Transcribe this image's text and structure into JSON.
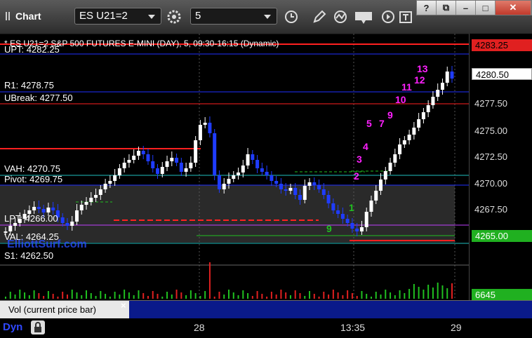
{
  "toolbar": {
    "title": "Chart",
    "symbol": "ES U21=2",
    "interval": "5"
  },
  "chart": {
    "header": "* ES U21=2 S&P 500 FUTURES E-MINI (DAY), 5, 09:30-16:15 (Dynamic)",
    "levels": {
      "upt": "UPT: 4282.25",
      "r1": "R1: 4278.75",
      "ubreak": "UBreak: 4277.50",
      "vah": "VAH: 4270.75",
      "pivot": "Pivot: 4269.75",
      "lpt": "LPT: 4266.00",
      "val": "VAL: 4264.25",
      "s1": "S1: 4262.50"
    },
    "watermark": "ElliottSurf.com",
    "price_axis": [
      "4277.50",
      "4275.00",
      "4272.50",
      "4270.00",
      "4267.50"
    ],
    "price_tags": {
      "red": "4283.25",
      "current": "4280.50",
      "green": "4265.00"
    },
    "setup_counts": [
      "13",
      "12",
      "11",
      "10",
      "5",
      "7",
      "9",
      "4",
      "3",
      "2",
      "1",
      "9"
    ],
    "colors": {
      "up_bar": "#ffffff",
      "down_bar": "#1f3cff",
      "resistance": "#ff2020",
      "support": "#20c020",
      "count": "#ff20ff"
    }
  },
  "volume": {
    "tab_label": "Vol (current price bar)",
    "close": "×",
    "value_tag": "6645"
  },
  "bottom": {
    "dyn": "Dyn",
    "time_labels": [
      "28",
      "13:35",
      "29"
    ]
  }
}
